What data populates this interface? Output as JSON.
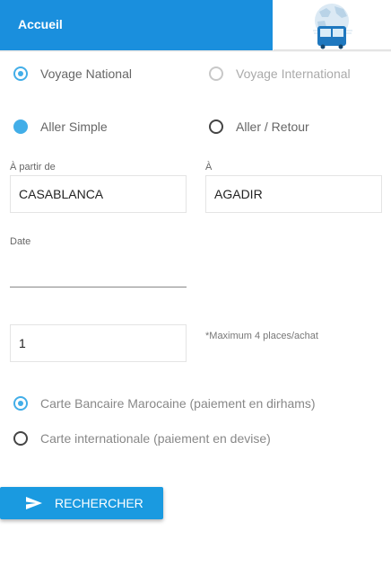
{
  "header": {
    "title": "Accueil",
    "logo_icon": "bus-globe-logo",
    "accent_color": "#1a8fdd"
  },
  "trip_scope": {
    "national_label": "Voyage National",
    "national_selected": true,
    "international_label": "Voyage International",
    "international_selected": false
  },
  "trip_type": {
    "one_way_label": "Aller Simple",
    "one_way_selected": true,
    "round_trip_label": "Aller / Retour",
    "round_trip_selected": false
  },
  "route": {
    "from_label": "À partir de",
    "from_value": "CASABLANCA",
    "to_label": "À",
    "to_value": "AGADIR"
  },
  "date": {
    "label": "Date",
    "value": ""
  },
  "seats": {
    "value": "1",
    "note": "*Maximum 4 places/achat"
  },
  "payment": {
    "moroccan_card_label": "Carte Bancaire Marocaine (paiement en dirhams)",
    "moroccan_card_selected": true,
    "international_card_label": "Carte internationale (paiement en devise)",
    "international_card_selected": false
  },
  "search": {
    "label": "RECHERCHER",
    "icon": "send-icon"
  }
}
